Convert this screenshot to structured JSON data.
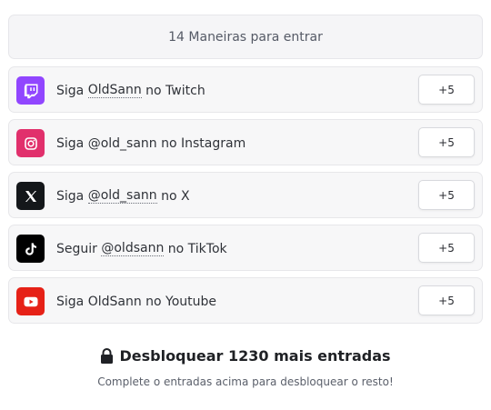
{
  "header": {
    "title": "14 Maneiras para entrar"
  },
  "entries": [
    {
      "prefix": "Siga ",
      "handle": "OldSann",
      "suffix": " no Twitch",
      "points": "+5",
      "icon": "twitch-icon",
      "color": "#9146ff"
    },
    {
      "prefix": "Siga @old_sann no Instagram",
      "handle": "",
      "suffix": "",
      "points": "+5",
      "icon": "instagram-icon",
      "color": "#e1306c"
    },
    {
      "prefix": "Siga ",
      "handle": "@old_sann",
      "suffix": " no X",
      "points": "+5",
      "icon": "x-icon",
      "color": "#14171a"
    },
    {
      "prefix": "Seguir ",
      "handle": "@oldsann",
      "suffix": " no TikTok",
      "points": "+5",
      "icon": "tiktok-icon",
      "color": "#000000"
    },
    {
      "prefix": "Siga OldSann no Youtube",
      "handle": "",
      "suffix": "",
      "points": "+5",
      "icon": "youtube-icon",
      "color": "#e62117"
    }
  ],
  "unlock": {
    "title": "Desbloquear 1230 mais entradas",
    "subtitle": "Complete o entradas acima para desbloquear o resto!",
    "icon": "lock-icon"
  }
}
